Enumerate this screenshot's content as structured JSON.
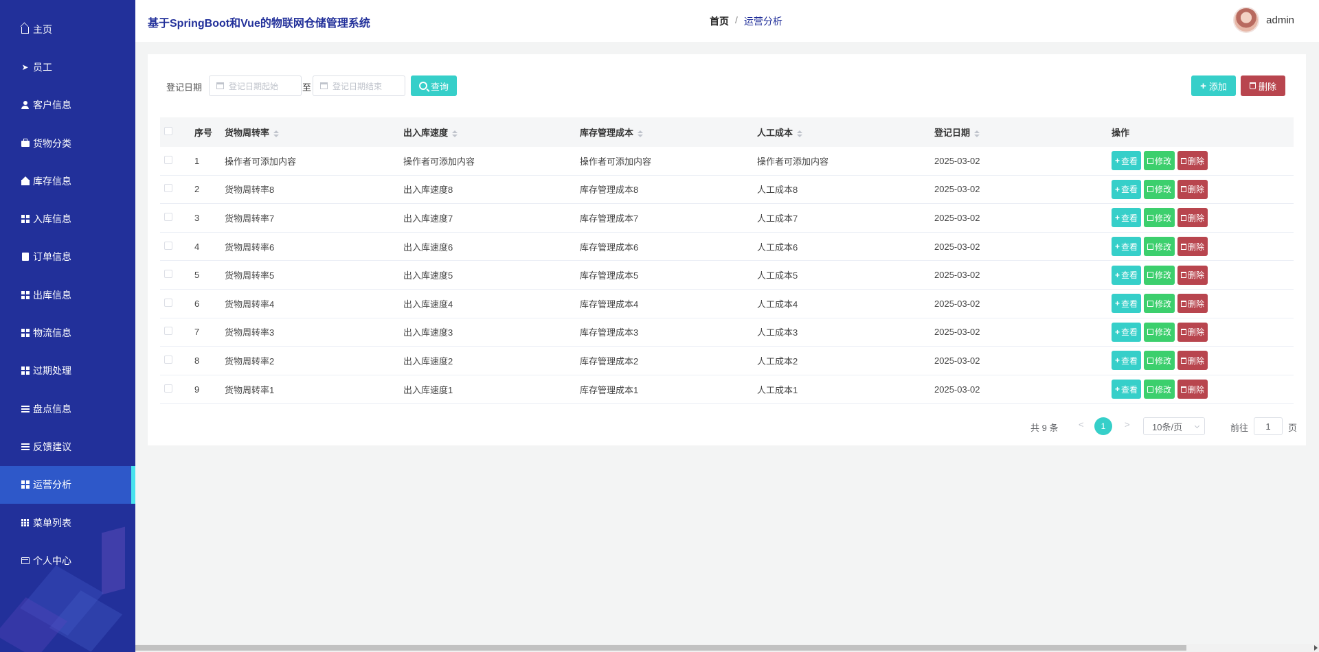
{
  "sidebar": {
    "items": [
      {
        "label": "主页",
        "icon": "home-icon"
      },
      {
        "label": "员工",
        "icon": "send-icon"
      },
      {
        "label": "客户信息",
        "icon": "user-icon"
      },
      {
        "label": "货物分类",
        "icon": "briefcase-icon"
      },
      {
        "label": "库存信息",
        "icon": "house-icon"
      },
      {
        "label": "入库信息",
        "icon": "grid-icon"
      },
      {
        "label": "订单信息",
        "icon": "clipboard-icon"
      },
      {
        "label": "出库信息",
        "icon": "grid-icon"
      },
      {
        "label": "物流信息",
        "icon": "grid-icon"
      },
      {
        "label": "过期处理",
        "icon": "grid-icon"
      },
      {
        "label": "盘点信息",
        "icon": "list-icon"
      },
      {
        "label": "反馈建议",
        "icon": "list-icon"
      },
      {
        "label": "运营分析",
        "icon": "grid-icon",
        "active": true
      },
      {
        "label": "菜单列表",
        "icon": "table-icon"
      },
      {
        "label": "个人中心",
        "icon": "card-icon"
      }
    ]
  },
  "header": {
    "title": "基于SpringBoot和Vue的物联网仓储管理系统",
    "breadcrumb_home": "首页",
    "breadcrumb_sep": "/",
    "breadcrumb_current": "运营分析",
    "username": "admin"
  },
  "search": {
    "label": "登记日期",
    "start_placeholder": "登记日期起始",
    "to": "至",
    "end_placeholder": "登记日期结束",
    "query_label": "查询",
    "add_label": "添加",
    "delete_label": "删除"
  },
  "table": {
    "headers": {
      "index": "序号",
      "col1": "货物周转率",
      "col2": "出入库速度",
      "col3": "库存管理成本",
      "col4": "人工成本",
      "col5": "登记日期",
      "ops": "操作"
    },
    "rows": [
      {
        "index": "1",
        "col1": "操作者可添加内容",
        "col2": "操作者可添加内容",
        "col3": "操作者可添加内容",
        "col4": "操作者可添加内容",
        "col5": "2025-03-02"
      },
      {
        "index": "2",
        "col1": "货物周转率8",
        "col2": "出入库速度8",
        "col3": "库存管理成本8",
        "col4": "人工成本8",
        "col5": "2025-03-02"
      },
      {
        "index": "3",
        "col1": "货物周转率7",
        "col2": "出入库速度7",
        "col3": "库存管理成本7",
        "col4": "人工成本7",
        "col5": "2025-03-02"
      },
      {
        "index": "4",
        "col1": "货物周转率6",
        "col2": "出入库速度6",
        "col3": "库存管理成本6",
        "col4": "人工成本6",
        "col5": "2025-03-02"
      },
      {
        "index": "5",
        "col1": "货物周转率5",
        "col2": "出入库速度5",
        "col3": "库存管理成本5",
        "col4": "人工成本5",
        "col5": "2025-03-02"
      },
      {
        "index": "6",
        "col1": "货物周转率4",
        "col2": "出入库速度4",
        "col3": "库存管理成本4",
        "col4": "人工成本4",
        "col5": "2025-03-02"
      },
      {
        "index": "7",
        "col1": "货物周转率3",
        "col2": "出入库速度3",
        "col3": "库存管理成本3",
        "col4": "人工成本3",
        "col5": "2025-03-02"
      },
      {
        "index": "8",
        "col1": "货物周转率2",
        "col2": "出入库速度2",
        "col3": "库存管理成本2",
        "col4": "人工成本2",
        "col5": "2025-03-02"
      },
      {
        "index": "9",
        "col1": "货物周转率1",
        "col2": "出入库速度1",
        "col3": "库存管理成本1",
        "col4": "人工成本1",
        "col5": "2025-03-02"
      }
    ],
    "op_view": "查看",
    "op_edit": "修改",
    "op_delete": "删除"
  },
  "pagination": {
    "total": "共 9 条",
    "prev": "<",
    "current_page": "1",
    "next": ">",
    "page_size": "10条/页",
    "goto_label": "前往",
    "goto_value": "1",
    "page_suffix": "页"
  },
  "colors": {
    "sidebar_bg": "#22309a",
    "active_item": "#2e58c9",
    "accent": "#36cfc9",
    "edit_green": "#3ccf6d",
    "danger": "#b8454e"
  }
}
